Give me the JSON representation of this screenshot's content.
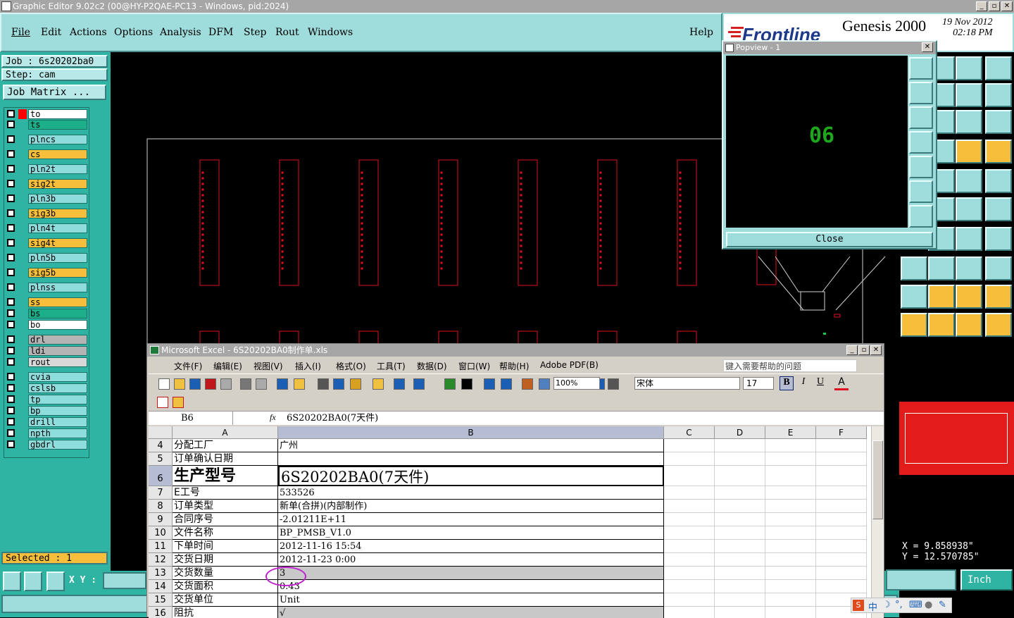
{
  "window": {
    "title": "Graphic Editor 9.02c2 (00@HY-P2QAE-PC13 - Windows, pid:2024)",
    "btn_min": "_",
    "btn_max": "▫",
    "btn_close": "✕"
  },
  "menu": {
    "items": [
      "File",
      "Edit",
      "Actions",
      "Options",
      "Analysis",
      "DFM",
      "Step",
      "Rout",
      "Windows"
    ],
    "help": "Help"
  },
  "brand": {
    "logo": "Frontline",
    "product": "Genesis 2000",
    "date": "19 Nov 2012",
    "time": "02:18 PM"
  },
  "job": {
    "job_line": "Job : 6s20202ba0",
    "step_line": "Step: cam",
    "matrix_button": "Job Matrix ..."
  },
  "layers": [
    {
      "name": "to",
      "color": "#ffffff",
      "marker": "#ff0000"
    },
    {
      "name": "ts",
      "color": "#1dae8a"
    },
    {
      "name": "plncs",
      "color": "#8fdcdc"
    },
    {
      "name": "cs",
      "color": "#f6be3a"
    },
    {
      "name": "pln2t",
      "color": "#8fdcdc"
    },
    {
      "name": "sig2t",
      "color": "#f6be3a"
    },
    {
      "name": "pln3b",
      "color": "#8fdcdc"
    },
    {
      "name": "sig3b",
      "color": "#f6be3a"
    },
    {
      "name": "pln4t",
      "color": "#8fdcdc"
    },
    {
      "name": "sig4t",
      "color": "#f6be3a"
    },
    {
      "name": "pln5b",
      "color": "#8fdcdc"
    },
    {
      "name": "sig5b",
      "color": "#f6be3a"
    },
    {
      "name": "plnss",
      "color": "#8fdcdc"
    },
    {
      "name": "ss",
      "color": "#f6be3a"
    },
    {
      "name": "bs",
      "color": "#1dae8a"
    },
    {
      "name": "bo",
      "color": "#ffffff"
    },
    {
      "name": "drl",
      "color": "#b4b4b4"
    },
    {
      "name": "ldi",
      "color": "#b4b4b4"
    },
    {
      "name": "rout",
      "color": "#d8d8d8"
    },
    {
      "name": "cvia",
      "color": "#8fdcdc"
    },
    {
      "name": "cslsb",
      "color": "#8fdcdc"
    },
    {
      "name": "tp",
      "color": "#8fdcdc"
    },
    {
      "name": "bp",
      "color": "#8fdcdc"
    },
    {
      "name": "drill",
      "color": "#8fdcdc"
    },
    {
      "name": "npth",
      "color": "#8fdcdc"
    },
    {
      "name": "gbdrl",
      "color": "#8fdcdc"
    }
  ],
  "status": {
    "selected": "Selected : 1",
    "xy_label": "X Y :",
    "x": "X = 9.858938\"",
    "y": "Y = 12.570785\"",
    "units": "Inch"
  },
  "popview": {
    "title": "Popview - 1",
    "label": "06",
    "close_button": "Close"
  },
  "excel": {
    "title": "Microsoft Excel - 6S20202BA0制作单.xls",
    "menus": [
      "文件(F)",
      "编辑(E)",
      "视图(V)",
      "插入(I)",
      "格式(O)",
      "工具(T)",
      "数据(D)",
      "窗口(W)",
      "帮助(H)",
      "Adobe PDF(B)"
    ],
    "help_placeholder": "键入需要帮助的问题",
    "zoom": "100%",
    "font": "宋体",
    "font_size": "17",
    "bold": "B",
    "italic": "I",
    "underline": "U",
    "name_box": "B6",
    "fx": "fx",
    "formula": "6S20202BA0(7天件)",
    "columns": [
      "A",
      "B",
      "C",
      "D",
      "E",
      "F"
    ],
    "rows": [
      {
        "n": "4",
        "a": "分配工厂",
        "b": "广州"
      },
      {
        "n": "5",
        "a": "订单确认日期",
        "b": ""
      },
      {
        "n": "6",
        "a": "生产型号",
        "b": "6S20202BA0(7天件)"
      },
      {
        "n": "7",
        "a": "E工号",
        "b": "533526"
      },
      {
        "n": "8",
        "a": "订单类型",
        "b": "新单(合拼)(内部制作)"
      },
      {
        "n": "9",
        "a": "合同序号",
        "b": "-2.01211E+11"
      },
      {
        "n": "10",
        "a": "文件名称",
        "b": "BP_PMSB_V1.0"
      },
      {
        "n": "11",
        "a": "下单时间",
        "b": "2012-11-16 15:54"
      },
      {
        "n": "12",
        "a": "交货日期",
        "b": "2012-11-23 0:00"
      },
      {
        "n": "13",
        "a": "交货数量",
        "b": "3"
      },
      {
        "n": "14",
        "a": "交货面积",
        "b": "0.43"
      },
      {
        "n": "15",
        "a": "交货单位",
        "b": "Unit"
      },
      {
        "n": "16",
        "a": "阻抗",
        "b": "√"
      }
    ]
  },
  "ime": {
    "label": "中"
  }
}
